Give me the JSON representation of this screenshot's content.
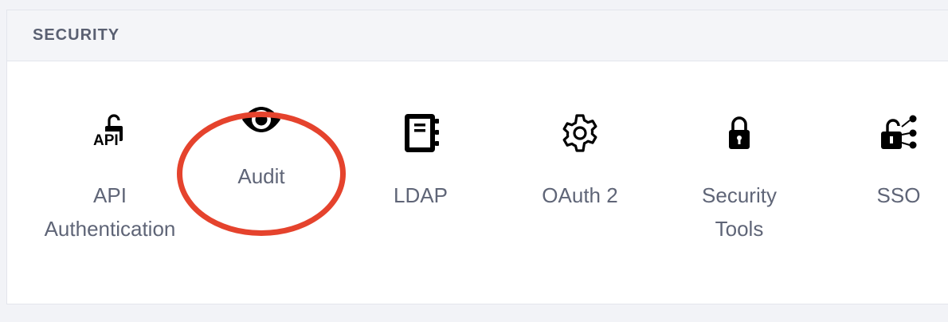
{
  "section": {
    "title": "SECURITY"
  },
  "tiles": [
    {
      "label": "API\nAuthentication",
      "icon": "api-lock-icon",
      "icon_text": "API"
    },
    {
      "label": "Audit",
      "icon": "eye-icon"
    },
    {
      "label": "LDAP",
      "icon": "address-book-icon"
    },
    {
      "label": "OAuth 2",
      "icon": "gear-icon"
    },
    {
      "label": "Security\nTools",
      "icon": "lock-icon"
    },
    {
      "label": "SSO",
      "icon": "unlock-share-icon"
    }
  ],
  "annotation": {
    "highlight_color": "#e5432d",
    "highlighted_tile": "Audit"
  },
  "colors": {
    "text": "#5f6577",
    "header_bg": "#f4f5f8",
    "page_bg": "#f2f3f7"
  }
}
